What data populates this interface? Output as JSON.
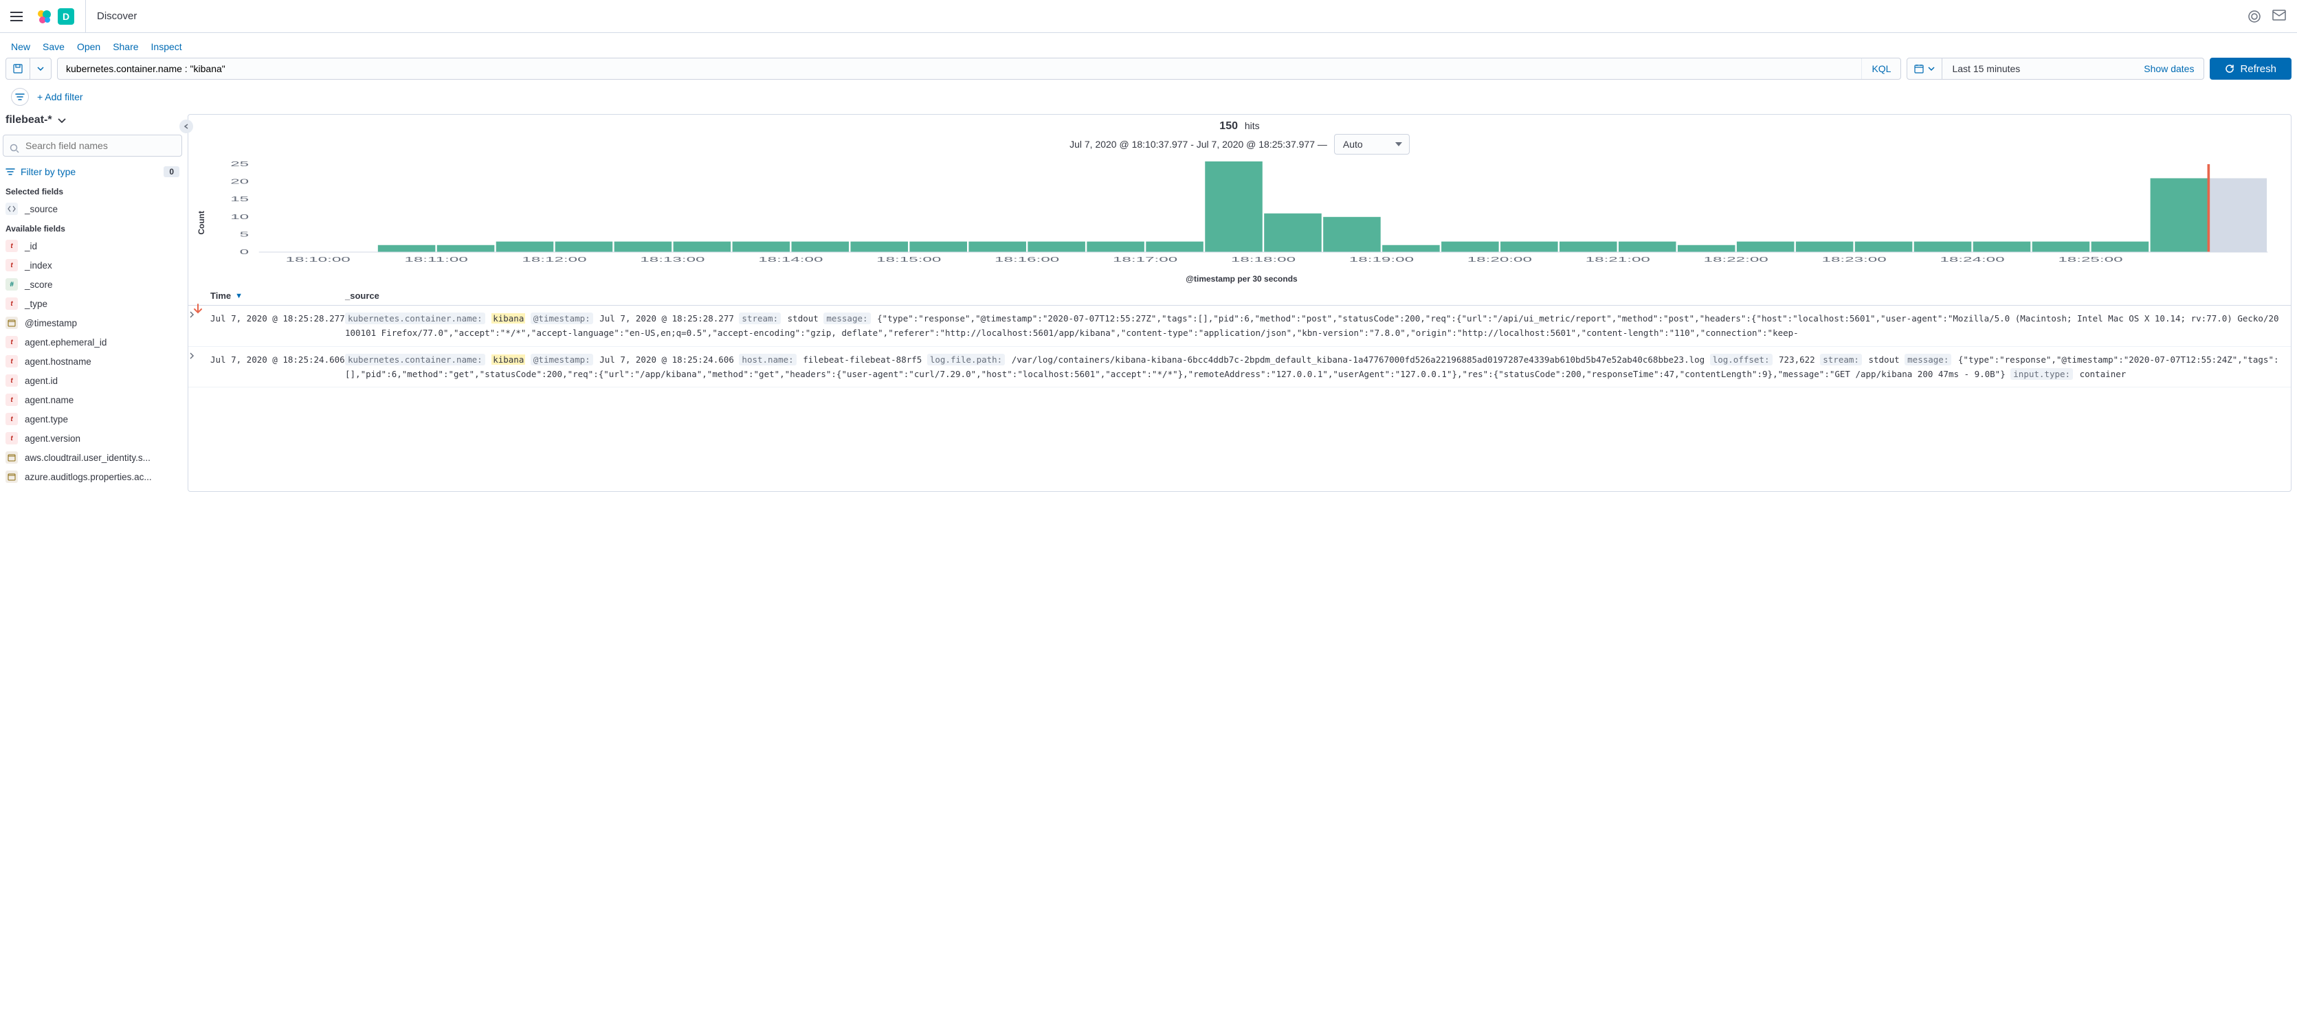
{
  "header": {
    "app_letter": "D",
    "breadcrumb": "Discover"
  },
  "actions": {
    "new": "New",
    "save": "Save",
    "open": "Open",
    "share": "Share",
    "inspect": "Inspect"
  },
  "query": {
    "value": "kubernetes.container.name : \"kibana\"",
    "lang": "KQL",
    "date_range": "Last 15 minutes",
    "show_dates": "Show dates",
    "refresh": "Refresh"
  },
  "filters": {
    "add_filter": "+ Add filter"
  },
  "sidebar": {
    "index_pattern": "filebeat-*",
    "search_placeholder": "Search field names",
    "filter_by_type": "Filter by type",
    "filter_count": "0",
    "selected_label": "Selected fields",
    "available_label": "Available fields",
    "selected": [
      {
        "type": "s",
        "name": "_source"
      }
    ],
    "available": [
      {
        "type": "t",
        "name": "_id"
      },
      {
        "type": "t",
        "name": "_index"
      },
      {
        "type": "n",
        "name": "_score"
      },
      {
        "type": "t",
        "name": "_type"
      },
      {
        "type": "d",
        "name": "@timestamp"
      },
      {
        "type": "t",
        "name": "agent.ephemeral_id"
      },
      {
        "type": "t",
        "name": "agent.hostname"
      },
      {
        "type": "t",
        "name": "agent.id"
      },
      {
        "type": "t",
        "name": "agent.name"
      },
      {
        "type": "t",
        "name": "agent.type"
      },
      {
        "type": "t",
        "name": "agent.version"
      },
      {
        "type": "d",
        "name": "aws.cloudtrail.user_identity.s..."
      },
      {
        "type": "d",
        "name": "azure.auditlogs.properties.ac..."
      }
    ]
  },
  "hits": {
    "count": "150",
    "label": "hits",
    "caption": "Jul 7, 2020 @ 18:10:37.977 - Jul 7, 2020 @ 18:25:37.977 —",
    "interval": "Auto",
    "yaxis_label": "Count",
    "xaxis_label": "@timestamp per 30 seconds"
  },
  "chart_data": {
    "type": "bar",
    "categories": [
      "18:10:00",
      "18:11:00",
      "18:12:00",
      "18:13:00",
      "18:14:00",
      "18:15:00",
      "18:16:00",
      "18:17:00",
      "18:18:00",
      "18:19:00",
      "18:20:00",
      "18:21:00",
      "18:22:00",
      "18:23:00",
      "18:24:00",
      "18:25:00"
    ],
    "bucket_seconds": 30,
    "ylim": [
      0,
      25
    ],
    "yticks": [
      0,
      5,
      10,
      15,
      20,
      25
    ],
    "values": [
      0,
      0,
      2,
      2,
      3,
      3,
      3,
      3,
      3,
      3,
      3,
      3,
      3,
      3,
      3,
      3,
      26,
      11,
      10,
      2,
      3,
      3,
      3,
      3,
      2,
      3,
      3,
      3,
      3,
      3,
      3,
      3,
      21,
      21
    ],
    "cursor_index": 32,
    "partial_last": true,
    "bar_color": "#54b399",
    "partial_color": "#d3dae6",
    "cursor_color": "#e7664c",
    "title": "",
    "xlabel": "@timestamp per 30 seconds",
    "ylabel": "Count"
  },
  "table": {
    "col_time": "Time",
    "col_source": "_source",
    "rows": [
      {
        "time": "Jul 7, 2020 @ 18:25:28.277",
        "kv": [
          {
            "k": "kubernetes.container.name:",
            "v": "kibana",
            "hl": true
          },
          {
            "k": "@timestamp:",
            "v": "Jul 7, 2020 @ 18:25:28.277"
          },
          {
            "k": "stream:",
            "v": "stdout"
          },
          {
            "k": "message:",
            "v": ""
          }
        ],
        "message": "{\"type\":\"response\",\"@timestamp\":\"2020-07-07T12:55:27Z\",\"tags\":[],\"pid\":6,\"method\":\"post\",\"statusCode\":200,\"req\":{\"url\":\"/api/ui_metric/report\",\"method\":\"post\",\"headers\":{\"host\":\"localhost:5601\",\"user-agent\":\"Mozilla/5.0 (Macintosh; Intel Mac OS X 10.14; rv:77.0) Gecko/20100101 Firefox/77.0\",\"accept\":\"*/*\",\"accept-language\":\"en-US,en;q=0.5\",\"accept-encoding\":\"gzip, deflate\",\"referer\":\"http://localhost:5601/app/kibana\",\"content-type\":\"application/json\",\"kbn-version\":\"7.8.0\",\"origin\":\"http://localhost:5601\",\"content-length\":\"110\",\"connection\":\"keep-"
      },
      {
        "time": "Jul 7, 2020 @ 18:25:24.606",
        "kv": [
          {
            "k": "kubernetes.container.name:",
            "v": "kibana",
            "hl": true
          },
          {
            "k": "@timestamp:",
            "v": "Jul 7, 2020 @ 18:25:24.606"
          },
          {
            "k": "host.name:",
            "v": "filebeat-filebeat-88rf5"
          },
          {
            "k": "log.file.path:",
            "v": "/var/log/containers/kibana-kibana-6bcc4ddb7c-2bpdm_default_kibana-1a47767000fd526a22196885ad0197287e4339ab610bd5b47e52ab40c68bbe23.log"
          },
          {
            "k": "log.offset:",
            "v": "723,622"
          },
          {
            "k": "stream:",
            "v": "stdout"
          },
          {
            "k": "message:",
            "v": ""
          }
        ],
        "message": "{\"type\":\"response\",\"@timestamp\":\"2020-07-07T12:55:24Z\",\"tags\":[],\"pid\":6,\"method\":\"get\",\"statusCode\":200,\"req\":{\"url\":\"/app/kibana\",\"method\":\"get\",\"headers\":{\"user-agent\":\"curl/7.29.0\",\"host\":\"localhost:5601\",\"accept\":\"*/*\"},\"remoteAddress\":\"127.0.0.1\",\"userAgent\":\"127.0.0.1\"},\"res\":{\"statusCode\":200,\"responseTime\":47,\"contentLength\":9},\"message\":\"GET /app/kibana 200 47ms - 9.0B\"}",
        "trailing_kv": [
          {
            "k": "input.type:",
            "v": "container"
          }
        ]
      }
    ]
  }
}
